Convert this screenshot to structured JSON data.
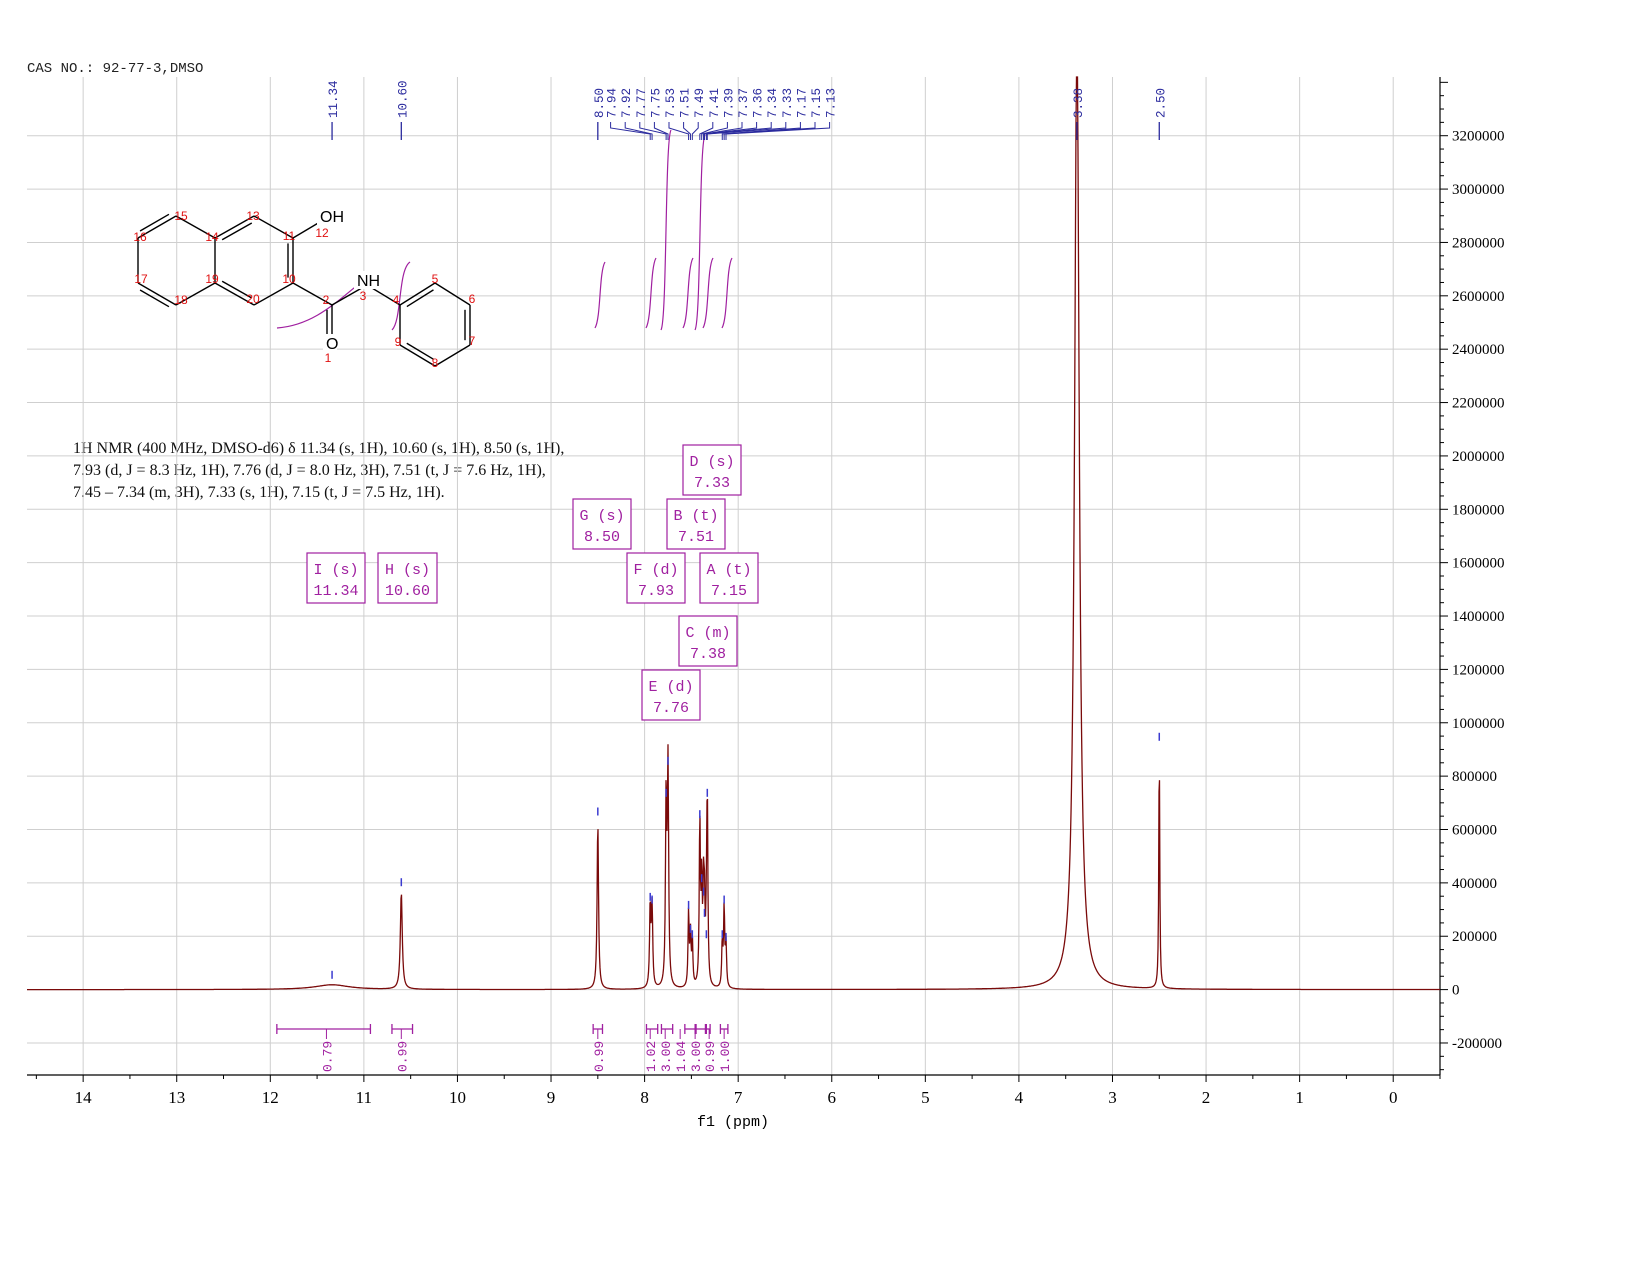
{
  "header": {
    "label": "CAS NO.: 92-77-3,DMSO"
  },
  "description": {
    "lines": [
      "1H NMR (400 MHz, DMSO-d6) δ 11.34 (s, 1H), 10.60 (s, 1H), 8.50 (s, 1H),",
      "7.93 (d, J = 8.3 Hz, 1H), 7.76 (d, J = 8.0 Hz, 3H), 7.51 (t, J = 7.6 Hz, 1H),",
      "7.45 – 7.34 (m, 3H), 7.33 (s, 1H), 7.15 (t, J = 7.5 Hz, 1H)."
    ]
  },
  "molecule": {
    "atoms": [
      "OH",
      "NH",
      "O"
    ],
    "numbers": [
      "1",
      "2",
      "3",
      "4",
      "5",
      "6",
      "7",
      "8",
      "9",
      "10",
      "11",
      "12",
      "13",
      "14",
      "15",
      "16",
      "17",
      "18",
      "19",
      "20"
    ]
  },
  "colors": {
    "spectrum": "#7a0a0a",
    "peak_labels": "#2b2b9e",
    "multiplets": "#a020a0",
    "atom_numbers": "#e01010",
    "grid": "#cfcfcf"
  },
  "chart_data": {
    "type": "line",
    "title": "",
    "xlabel": "f1 (ppm)",
    "ylabel": "",
    "xlim": [
      14.6,
      -0.5
    ],
    "ylim": [
      -320000,
      3420000
    ],
    "x_ticks": [
      14,
      13,
      12,
      11,
      10,
      9,
      8,
      7,
      6,
      5,
      4,
      3,
      2,
      1,
      0
    ],
    "y_ticks": [
      3200000,
      3000000,
      2800000,
      2600000,
      2400000,
      2200000,
      2000000,
      1800000,
      1600000,
      1400000,
      1200000,
      1000000,
      800000,
      600000,
      400000,
      200000,
      0,
      -200000
    ],
    "y_tick_labels": [
      "3200000",
      "3000000",
      "2800000",
      "2600000",
      "2400000",
      "2200000",
      "2000000",
      "1800000",
      "1600000",
      "1400000",
      "1200000",
      "1000000",
      "800000",
      "600000",
      "400000",
      "200000",
      "0",
      "-200000"
    ],
    "grid": true,
    "peaks": [
      {
        "ppm": 11.34,
        "height": 18000,
        "width": 0.22
      },
      {
        "ppm": 10.6,
        "height": 365000,
        "width": 0.012
      },
      {
        "ppm": 8.5,
        "height": 630000,
        "width": 0.009
      },
      {
        "ppm": 7.94,
        "height": 310000,
        "width": 0.008
      },
      {
        "ppm": 7.92,
        "height": 300000,
        "width": 0.008
      },
      {
        "ppm": 7.77,
        "height": 700000,
        "width": 0.008
      },
      {
        "ppm": 7.75,
        "height": 820000,
        "width": 0.008
      },
      {
        "ppm": 7.53,
        "height": 280000,
        "width": 0.007
      },
      {
        "ppm": 7.51,
        "height": 190000,
        "width": 0.007
      },
      {
        "ppm": 7.49,
        "height": 170000,
        "width": 0.007
      },
      {
        "ppm": 7.41,
        "height": 620000,
        "width": 0.007
      },
      {
        "ppm": 7.39,
        "height": 380000,
        "width": 0.007
      },
      {
        "ppm": 7.37,
        "height": 330000,
        "width": 0.007
      },
      {
        "ppm": 7.36,
        "height": 250000,
        "width": 0.007
      },
      {
        "ppm": 7.34,
        "height": 170000,
        "width": 0.007
      },
      {
        "ppm": 7.33,
        "height": 700000,
        "width": 0.007
      },
      {
        "ppm": 7.17,
        "height": 170000,
        "width": 0.007
      },
      {
        "ppm": 7.15,
        "height": 300000,
        "width": 0.007
      },
      {
        "ppm": 7.13,
        "height": 160000,
        "width": 0.007
      },
      {
        "ppm": 3.38,
        "height": 3600000,
        "width": 0.03
      },
      {
        "ppm": 2.5,
        "height": 910000,
        "width": 0.006
      }
    ],
    "peak_labels": [
      {
        "ppm": 11.34,
        "text": "11.34"
      },
      {
        "ppm": 10.6,
        "text": "10.60"
      },
      {
        "ppm": 8.5,
        "text": "8.50"
      },
      {
        "ppm": 7.94,
        "text": "7.94"
      },
      {
        "ppm": 7.92,
        "text": "7.92"
      },
      {
        "ppm": 7.77,
        "text": "7.77"
      },
      {
        "ppm": 7.75,
        "text": "7.75"
      },
      {
        "ppm": 7.53,
        "text": "7.53"
      },
      {
        "ppm": 7.51,
        "text": "7.51"
      },
      {
        "ppm": 7.49,
        "text": "7.49"
      },
      {
        "ppm": 7.41,
        "text": "7.41"
      },
      {
        "ppm": 7.39,
        "text": "7.39"
      },
      {
        "ppm": 7.37,
        "text": "7.37"
      },
      {
        "ppm": 7.36,
        "text": "7.36"
      },
      {
        "ppm": 7.34,
        "text": "7.34"
      },
      {
        "ppm": 7.33,
        "text": "7.33"
      },
      {
        "ppm": 7.17,
        "text": "7.17"
      },
      {
        "ppm": 7.15,
        "text": "7.15"
      },
      {
        "ppm": 7.13,
        "text": "7.13"
      },
      {
        "ppm": 3.38,
        "text": "3.38"
      },
      {
        "ppm": 2.5,
        "text": "2.50"
      }
    ],
    "integrals": [
      {
        "from": 11.93,
        "to": 10.93,
        "label_ppm": 11.4,
        "value": "0.79"
      },
      {
        "from": 10.7,
        "to": 10.48,
        "label_ppm": 10.6,
        "value": "0.99"
      },
      {
        "from": 8.55,
        "to": 8.45,
        "label_ppm": 8.5,
        "value": "0.99"
      },
      {
        "from": 7.98,
        "to": 7.86,
        "label_ppm": 7.94,
        "value": "1.02"
      },
      {
        "from": 7.82,
        "to": 7.7,
        "label_ppm": 7.78,
        "value": "3.00"
      },
      {
        "from": 7.57,
        "to": 7.46,
        "label_ppm": 7.62,
        "value": "1.04"
      },
      {
        "from": 7.45,
        "to": 7.34,
        "label_ppm": 7.46,
        "value": "3.00"
      },
      {
        "from": 7.35,
        "to": 7.3,
        "label_ppm": 7.31,
        "value": "0.99"
      },
      {
        "from": 7.19,
        "to": 7.11,
        "label_ppm": 7.15,
        "value": "1.00"
      }
    ],
    "multiplets": [
      {
        "letter": "I (s)",
        "shift": "11.34"
      },
      {
        "letter": "H (s)",
        "shift": "10.60"
      },
      {
        "letter": "G (s)",
        "shift": "8.50"
      },
      {
        "letter": "F (d)",
        "shift": "7.93"
      },
      {
        "letter": "E (d)",
        "shift": "7.76"
      },
      {
        "letter": "B (t)",
        "shift": "7.51"
      },
      {
        "letter": "C (m)",
        "shift": "7.38"
      },
      {
        "letter": "D (s)",
        "shift": "7.33"
      },
      {
        "letter": "A (t)",
        "shift": "7.15"
      }
    ]
  }
}
